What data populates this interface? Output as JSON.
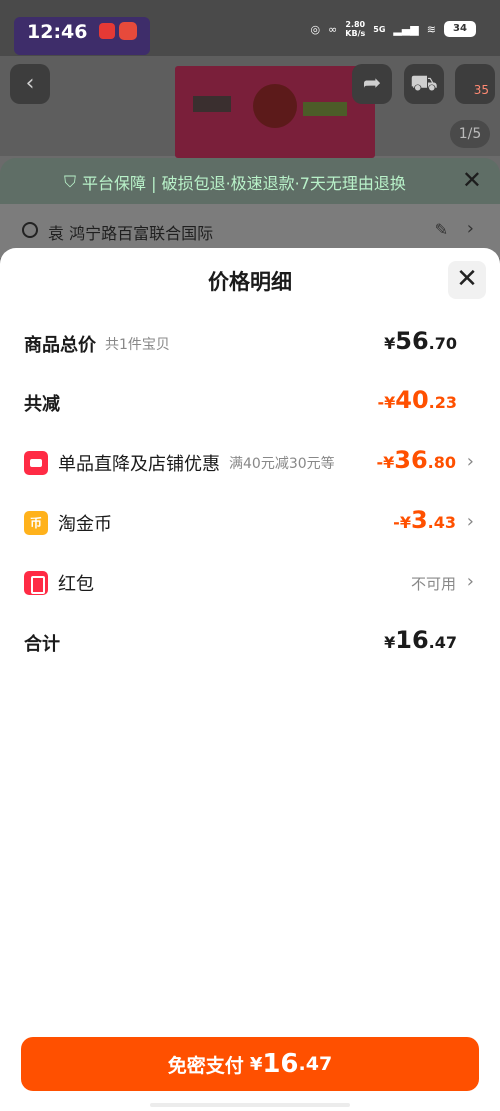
{
  "status_bar": {
    "time": "12:46",
    "net_speed": "2.80",
    "net_unit": "KB/s",
    "network": "5G",
    "battery": "34"
  },
  "background": {
    "cart_badge": "35",
    "image_counter": "1/5",
    "guarantee": "平台保障 | 破损包退·极速退款·7天无理由退换",
    "address": "袁 鸿宁路百富联合国际"
  },
  "sheet": {
    "title": "价格明细",
    "rows": [
      {
        "label": "商品总价",
        "sub": "共1件宝贝",
        "currency": "¥",
        "int": "56",
        "dec": ".70"
      },
      {
        "label": "共减",
        "currency": "-¥",
        "int": "40",
        "dec": ".23"
      },
      {
        "label": "单品直降及店铺优惠",
        "sub": "满40元减30元等",
        "currency": "-¥",
        "int": "36",
        "dec": ".80"
      },
      {
        "label": "淘金币",
        "icon_text": "币",
        "currency": "-¥",
        "int": "3",
        "dec": ".43"
      },
      {
        "label": "红包",
        "status": "不可用"
      },
      {
        "label": "合计",
        "currency": "¥",
        "int": "16",
        "dec": ".47"
      }
    ]
  },
  "pay_button": {
    "label": "免密支付",
    "currency": "¥",
    "int": "16",
    "dec": ".47"
  },
  "colors": {
    "accent": "#ff5000",
    "discount_icon": "#ff2b45",
    "coin_icon": "#ffb21c"
  },
  "icons": [
    "back-arrow-icon",
    "share-icon",
    "cart-icon",
    "shield-check-icon",
    "close-icon",
    "location-pin-icon",
    "edit-icon",
    "chevron-right-icon",
    "discount-tag-icon",
    "coin-icon",
    "red-envelope-icon"
  ]
}
